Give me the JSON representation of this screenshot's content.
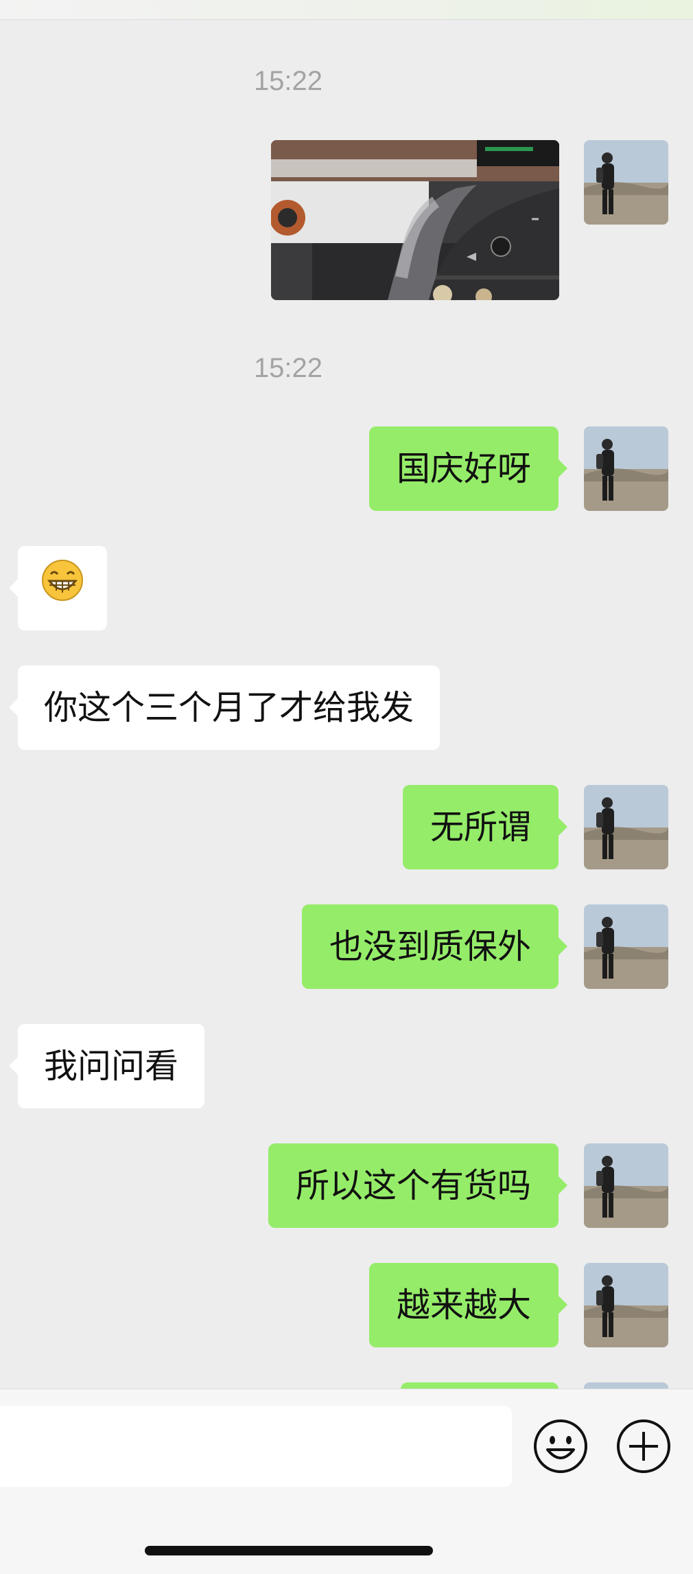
{
  "chat": {
    "timestamps": [
      "15:22",
      "15:22"
    ],
    "messages": [
      {
        "from": "me",
        "type": "image",
        "description": "car-interior-steering-wheel-photo"
      },
      {
        "from": "me",
        "type": "text",
        "text": "国庆好呀"
      },
      {
        "from": "them",
        "type": "emoji",
        "text": "😁"
      },
      {
        "from": "them",
        "type": "text",
        "text": "你这个三个月了才给我发"
      },
      {
        "from": "me",
        "type": "text",
        "text": "无所谓"
      },
      {
        "from": "me",
        "type": "text",
        "text": "也没到质保外"
      },
      {
        "from": "them",
        "type": "text",
        "text": "我问问看"
      },
      {
        "from": "me",
        "type": "text",
        "text": "所以这个有货吗"
      },
      {
        "from": "me",
        "type": "text",
        "text": "越来越大"
      }
    ]
  },
  "input": {
    "value": "",
    "placeholder": ""
  },
  "icons": {
    "emoji": "smiley-face-icon",
    "more": "plus-circle-icon"
  },
  "colors": {
    "sent_bubble": "#95ec69",
    "received_bubble": "#ffffff",
    "background": "#ededed"
  }
}
